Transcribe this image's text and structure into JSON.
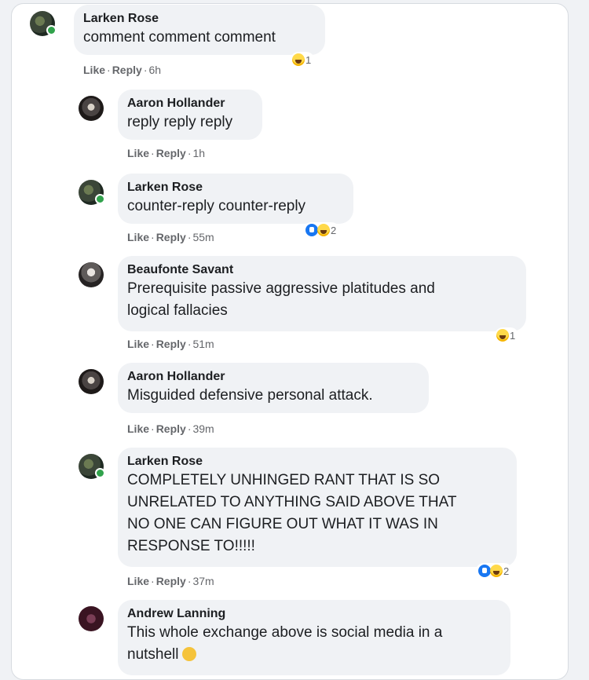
{
  "comments": [
    {
      "name": "Larken Rose",
      "text": "comment comment comment",
      "actions": [
        "Like",
        "Reply"
      ],
      "time": "6h",
      "reactions": {
        "types": [
          "haha"
        ],
        "count": "1"
      }
    },
    {
      "name": "Aaron Hollander",
      "text": "reply reply reply",
      "actions": [
        "Like",
        "Reply"
      ],
      "time": "1h"
    },
    {
      "name": "Larken Rose",
      "text": "counter-reply counter-reply",
      "actions": [
        "Like",
        "Reply"
      ],
      "time": "55m",
      "reactions": {
        "types": [
          "like",
          "haha"
        ],
        "count": "2"
      }
    },
    {
      "name": "Beaufonte Savant",
      "text": "Prerequisite passive aggressive platitudes and\nlogical fallacies",
      "actions": [
        "Like",
        "Reply"
      ],
      "time": "51m",
      "reactions": {
        "types": [
          "haha"
        ],
        "count": "1"
      }
    },
    {
      "name": "Aaron Hollander",
      "text": "Misguided defensive personal attack.",
      "actions": [
        "Like",
        "Reply"
      ],
      "time": "39m"
    },
    {
      "name": "Larken Rose",
      "text": "COMPLETELY UNHINGED RANT THAT IS SO\nUNRELATED TO ANYTHING SAID ABOVE THAT\nNO ONE CAN FIGURE OUT WHAT IT WAS IN\nRESPONSE TO!!!!!",
      "actions": [
        "Like",
        "Reply"
      ],
      "time": "37m",
      "reactions": {
        "types": [
          "like",
          "haha"
        ],
        "count": "2"
      }
    },
    {
      "name": "Andrew Lanning",
      "text": "This whole exchange above is social media in a\nnutshell",
      "inline_emoji": "grinning-sweat-emoji"
    }
  ],
  "colors": {
    "meta_text": "#65676b",
    "bubble": "#f0f2f5",
    "like_blue": "#1877f2",
    "online_green": "#31a24c"
  }
}
